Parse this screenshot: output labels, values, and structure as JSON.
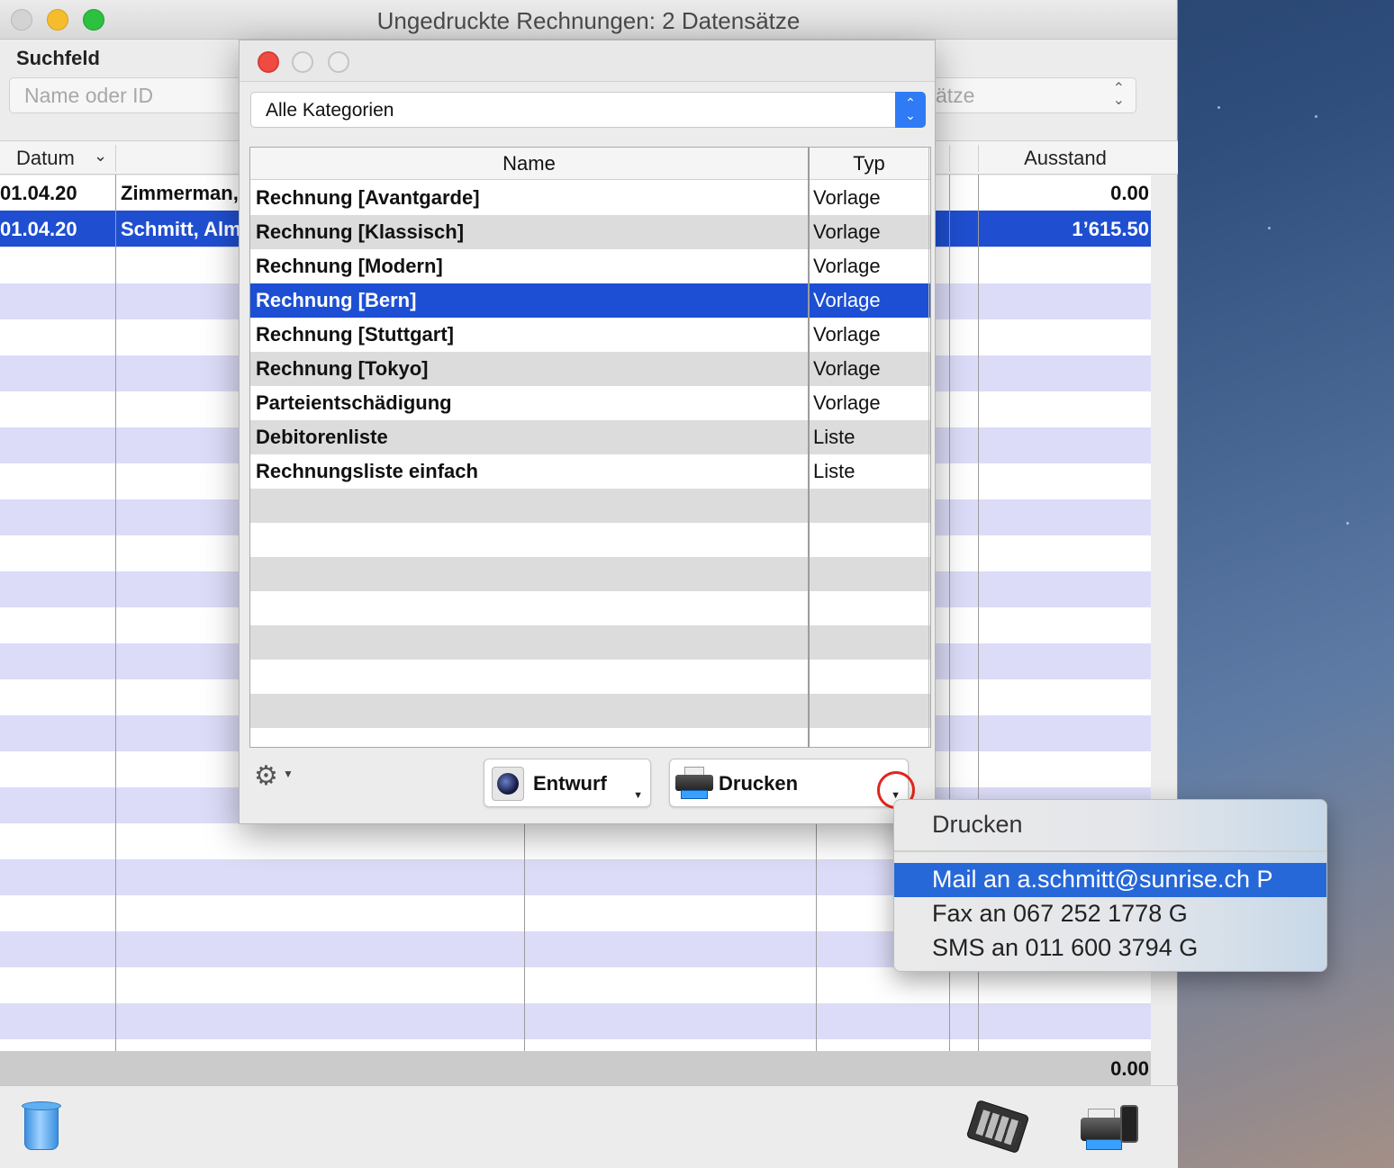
{
  "window": {
    "title": "Ungedruckte Rechnungen: 2 Datensätze"
  },
  "search": {
    "label": "Suchfeld",
    "placeholder": "Name oder ID",
    "filter_value_partial": "ätze"
  },
  "list": {
    "columns": {
      "datum": "Datum",
      "ausstand": "Ausstand"
    },
    "rows": [
      {
        "datum": "01.04.20",
        "name": "Zimmerman,",
        "ausstand": "0.00",
        "selected": false
      },
      {
        "datum": "01.04.20",
        "name": "Schmitt, Alm",
        "ausstand": "1’615.50",
        "selected": true
      }
    ],
    "total": "0.00"
  },
  "dialog": {
    "category": "Alle Kategorien",
    "columns": {
      "name": "Name",
      "typ": "Typ"
    },
    "rows": [
      {
        "name": "Rechnung [Avantgarde]",
        "typ": "Vorlage"
      },
      {
        "name": "Rechnung [Klassisch]",
        "typ": "Vorlage"
      },
      {
        "name": "Rechnung [Modern]",
        "typ": "Vorlage"
      },
      {
        "name": "Rechnung [Bern]",
        "typ": "Vorlage"
      },
      {
        "name": "Rechnung [Stuttgart]",
        "typ": "Vorlage"
      },
      {
        "name": "Rechnung [Tokyo]",
        "typ": "Vorlage"
      },
      {
        "name": "Parteientschädigung",
        "typ": "Vorlage"
      },
      {
        "name": "Debitorenliste",
        "typ": "Liste"
      },
      {
        "name": "Rechnungsliste einfach",
        "typ": "Liste"
      }
    ],
    "selected_row": 3,
    "buttons": {
      "entwurf": "Entwurf",
      "drucken": "Drucken"
    }
  },
  "menu": {
    "header": "Drucken",
    "items": [
      "Mail an a.schmitt@sunrise.ch P",
      "Fax an 067 252 1778 G",
      "SMS an 011 600 3794 G"
    ],
    "highlighted": 0
  },
  "colors": {
    "selection": "#1f4fd0",
    "menu_highlight": "#2768d8",
    "stripe": "#dcdcf8"
  },
  "icons": [
    "trash-icon",
    "calculator-icon",
    "fax-printer-icon",
    "gear-icon",
    "printer-icon",
    "lens-icon"
  ]
}
